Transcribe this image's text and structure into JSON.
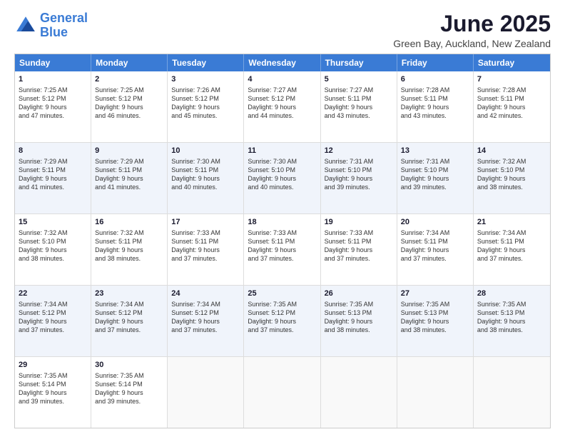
{
  "logo": {
    "line1": "General",
    "line2": "Blue"
  },
  "title": "June 2025",
  "subtitle": "Green Bay, Auckland, New Zealand",
  "header_days": [
    "Sunday",
    "Monday",
    "Tuesday",
    "Wednesday",
    "Thursday",
    "Friday",
    "Saturday"
  ],
  "rows": [
    [
      {
        "day": "1",
        "lines": [
          "Sunrise: 7:25 AM",
          "Sunset: 5:12 PM",
          "Daylight: 9 hours",
          "and 47 minutes."
        ]
      },
      {
        "day": "2",
        "lines": [
          "Sunrise: 7:25 AM",
          "Sunset: 5:12 PM",
          "Daylight: 9 hours",
          "and 46 minutes."
        ]
      },
      {
        "day": "3",
        "lines": [
          "Sunrise: 7:26 AM",
          "Sunset: 5:12 PM",
          "Daylight: 9 hours",
          "and 45 minutes."
        ]
      },
      {
        "day": "4",
        "lines": [
          "Sunrise: 7:27 AM",
          "Sunset: 5:12 PM",
          "Daylight: 9 hours",
          "and 44 minutes."
        ]
      },
      {
        "day": "5",
        "lines": [
          "Sunrise: 7:27 AM",
          "Sunset: 5:11 PM",
          "Daylight: 9 hours",
          "and 43 minutes."
        ]
      },
      {
        "day": "6",
        "lines": [
          "Sunrise: 7:28 AM",
          "Sunset: 5:11 PM",
          "Daylight: 9 hours",
          "and 43 minutes."
        ]
      },
      {
        "day": "7",
        "lines": [
          "Sunrise: 7:28 AM",
          "Sunset: 5:11 PM",
          "Daylight: 9 hours",
          "and 42 minutes."
        ]
      }
    ],
    [
      {
        "day": "8",
        "lines": [
          "Sunrise: 7:29 AM",
          "Sunset: 5:11 PM",
          "Daylight: 9 hours",
          "and 41 minutes."
        ]
      },
      {
        "day": "9",
        "lines": [
          "Sunrise: 7:29 AM",
          "Sunset: 5:11 PM",
          "Daylight: 9 hours",
          "and 41 minutes."
        ]
      },
      {
        "day": "10",
        "lines": [
          "Sunrise: 7:30 AM",
          "Sunset: 5:11 PM",
          "Daylight: 9 hours",
          "and 40 minutes."
        ]
      },
      {
        "day": "11",
        "lines": [
          "Sunrise: 7:30 AM",
          "Sunset: 5:10 PM",
          "Daylight: 9 hours",
          "and 40 minutes."
        ]
      },
      {
        "day": "12",
        "lines": [
          "Sunrise: 7:31 AM",
          "Sunset: 5:10 PM",
          "Daylight: 9 hours",
          "and 39 minutes."
        ]
      },
      {
        "day": "13",
        "lines": [
          "Sunrise: 7:31 AM",
          "Sunset: 5:10 PM",
          "Daylight: 9 hours",
          "and 39 minutes."
        ]
      },
      {
        "day": "14",
        "lines": [
          "Sunrise: 7:32 AM",
          "Sunset: 5:10 PM",
          "Daylight: 9 hours",
          "and 38 minutes."
        ]
      }
    ],
    [
      {
        "day": "15",
        "lines": [
          "Sunrise: 7:32 AM",
          "Sunset: 5:10 PM",
          "Daylight: 9 hours",
          "and 38 minutes."
        ]
      },
      {
        "day": "16",
        "lines": [
          "Sunrise: 7:32 AM",
          "Sunset: 5:11 PM",
          "Daylight: 9 hours",
          "and 38 minutes."
        ]
      },
      {
        "day": "17",
        "lines": [
          "Sunrise: 7:33 AM",
          "Sunset: 5:11 PM",
          "Daylight: 9 hours",
          "and 37 minutes."
        ]
      },
      {
        "day": "18",
        "lines": [
          "Sunrise: 7:33 AM",
          "Sunset: 5:11 PM",
          "Daylight: 9 hours",
          "and 37 minutes."
        ]
      },
      {
        "day": "19",
        "lines": [
          "Sunrise: 7:33 AM",
          "Sunset: 5:11 PM",
          "Daylight: 9 hours",
          "and 37 minutes."
        ]
      },
      {
        "day": "20",
        "lines": [
          "Sunrise: 7:34 AM",
          "Sunset: 5:11 PM",
          "Daylight: 9 hours",
          "and 37 minutes."
        ]
      },
      {
        "day": "21",
        "lines": [
          "Sunrise: 7:34 AM",
          "Sunset: 5:11 PM",
          "Daylight: 9 hours",
          "and 37 minutes."
        ]
      }
    ],
    [
      {
        "day": "22",
        "lines": [
          "Sunrise: 7:34 AM",
          "Sunset: 5:12 PM",
          "Daylight: 9 hours",
          "and 37 minutes."
        ]
      },
      {
        "day": "23",
        "lines": [
          "Sunrise: 7:34 AM",
          "Sunset: 5:12 PM",
          "Daylight: 9 hours",
          "and 37 minutes."
        ]
      },
      {
        "day": "24",
        "lines": [
          "Sunrise: 7:34 AM",
          "Sunset: 5:12 PM",
          "Daylight: 9 hours",
          "and 37 minutes."
        ]
      },
      {
        "day": "25",
        "lines": [
          "Sunrise: 7:35 AM",
          "Sunset: 5:12 PM",
          "Daylight: 9 hours",
          "and 37 minutes."
        ]
      },
      {
        "day": "26",
        "lines": [
          "Sunrise: 7:35 AM",
          "Sunset: 5:13 PM",
          "Daylight: 9 hours",
          "and 38 minutes."
        ]
      },
      {
        "day": "27",
        "lines": [
          "Sunrise: 7:35 AM",
          "Sunset: 5:13 PM",
          "Daylight: 9 hours",
          "and 38 minutes."
        ]
      },
      {
        "day": "28",
        "lines": [
          "Sunrise: 7:35 AM",
          "Sunset: 5:13 PM",
          "Daylight: 9 hours",
          "and 38 minutes."
        ]
      }
    ],
    [
      {
        "day": "29",
        "lines": [
          "Sunrise: 7:35 AM",
          "Sunset: 5:14 PM",
          "Daylight: 9 hours",
          "and 39 minutes."
        ]
      },
      {
        "day": "30",
        "lines": [
          "Sunrise: 7:35 AM",
          "Sunset: 5:14 PM",
          "Daylight: 9 hours",
          "and 39 minutes."
        ]
      },
      {
        "day": "",
        "lines": []
      },
      {
        "day": "",
        "lines": []
      },
      {
        "day": "",
        "lines": []
      },
      {
        "day": "",
        "lines": []
      },
      {
        "day": "",
        "lines": []
      }
    ]
  ]
}
